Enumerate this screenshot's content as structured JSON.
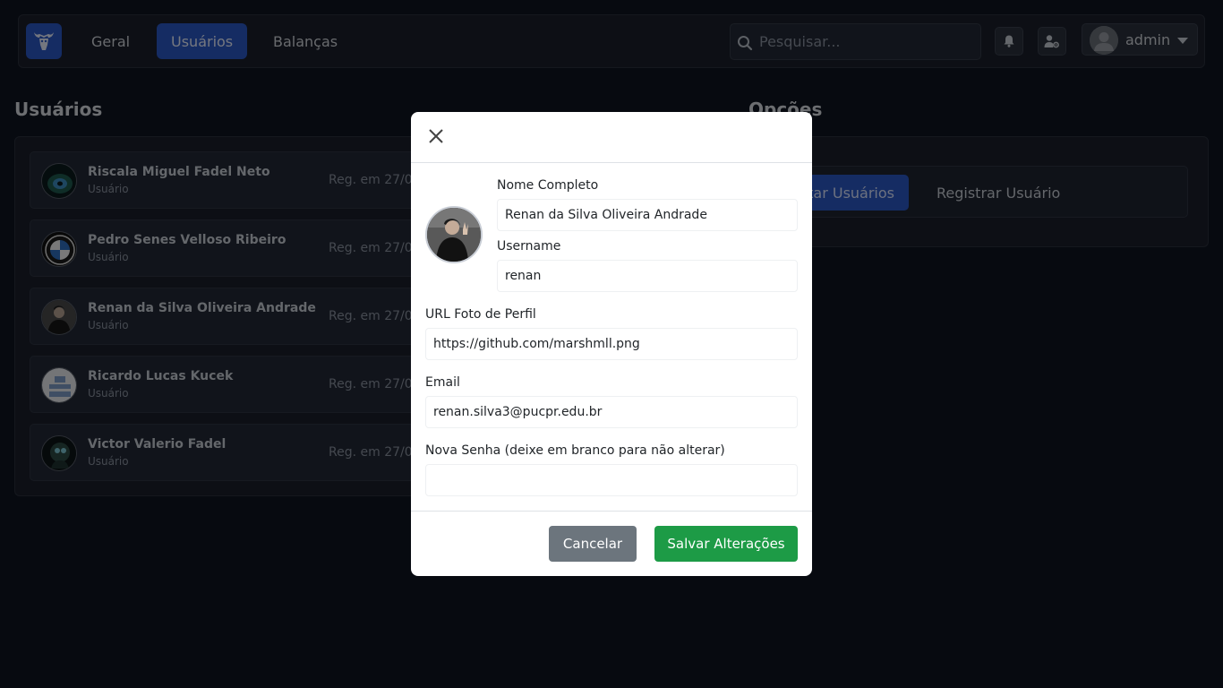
{
  "navbar": {
    "logo_icon": "bull-head-icon",
    "links": [
      {
        "label": "Geral",
        "active": false
      },
      {
        "label": "Usuários",
        "active": true
      },
      {
        "label": "Balanças",
        "active": false
      }
    ],
    "search_placeholder": "Pesquisar...",
    "notifications_icon": "bell-icon",
    "user_settings_icon": "user-gear-icon",
    "username": "admin"
  },
  "users_section": {
    "title": "Usuários",
    "users": [
      {
        "name": "Riscala Miguel Fadel Neto",
        "role": "Usuário",
        "registered": "Reg. em 27/04"
      },
      {
        "name": "Pedro Senes Velloso Ribeiro",
        "role": "Usuário",
        "registered": "Reg. em 27/04"
      },
      {
        "name": "Renan da Silva Oliveira Andrade",
        "role": "Usuário",
        "registered": "Reg. em 27/04"
      },
      {
        "name": "Ricardo Lucas Kucek",
        "role": "Usuário",
        "registered": "Reg. em 27/04"
      },
      {
        "name": "Victor Valerio Fadel",
        "role": "Usuário",
        "registered": "Reg. em 27/04"
      }
    ]
  },
  "options_section": {
    "title": "Opções",
    "list_button": "tar Usuários",
    "register_button": "Registrar Usuário"
  },
  "modal": {
    "fields": {
      "full_name_label": "Nome Completo",
      "full_name_value": "Renan da Silva Oliveira Andrade",
      "username_label": "Username",
      "username_value": "renan",
      "photo_url_label": "URL Foto de Perfil",
      "photo_url_value": "https://github.com/marshmll.png",
      "email_label": "Email",
      "email_value": "renan.silva3@pucpr.edu.br",
      "password_label": "Nova Senha (deixe em branco para não alterar)",
      "password_value": ""
    },
    "cancel_label": "Cancelar",
    "save_label": "Salvar Alterações"
  },
  "colors": {
    "background": "#0f1420",
    "panel": "#1a1f2b",
    "primary": "#2b58c6",
    "success": "#1d9b46",
    "secondary": "#6c757d"
  }
}
